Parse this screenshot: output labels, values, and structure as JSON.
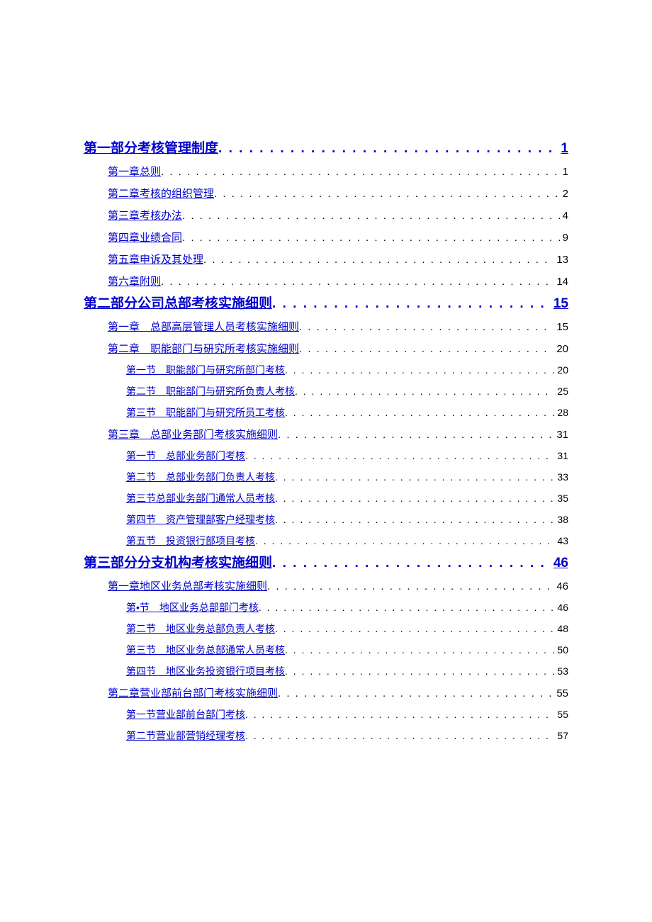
{
  "toc": [
    {
      "level": 1,
      "title": "第一部分考核管理制度",
      "page": "1"
    },
    {
      "level": 2,
      "title": "第一章总则",
      "page": "1"
    },
    {
      "level": 2,
      "title": "第二章考核的组织管理",
      "page": "2"
    },
    {
      "level": 2,
      "title": "第三章考核办法",
      "page": "4"
    },
    {
      "level": 2,
      "title": "第四章业绩合同",
      "page": "9"
    },
    {
      "level": 2,
      "title": "第五章申诉及其处理",
      "page": "13"
    },
    {
      "level": 2,
      "title": "第六章附则",
      "page": "14"
    },
    {
      "level": 1,
      "title": "第二部分公司总部考核实施细则",
      "page": "15"
    },
    {
      "level": 2,
      "title": "第一章　总部高层管理人员考核实施细则",
      "page": "15"
    },
    {
      "level": 2,
      "title": "第二章　职能部门与研究所考核实施细则",
      "page": "20"
    },
    {
      "level": 3,
      "title": "第一节　职能部门与研究所部门考核",
      "page": "20"
    },
    {
      "level": 3,
      "title": "第二节　职能部门与研究所负责人考核",
      "page": "25"
    },
    {
      "level": 3,
      "title": "第三节　职能部门与研究所员工考核",
      "page": "28"
    },
    {
      "level": 2,
      "title": "第三章　总部业务部门考核实施细则",
      "page": "31"
    },
    {
      "level": 3,
      "title": "第一节　总部业务部门考核",
      "page": "31"
    },
    {
      "level": 3,
      "title": "第二节　总部业务部门负责人考核",
      "page": "33"
    },
    {
      "level": 3,
      "title": "第三节总部业务部门通常人员考核",
      "page": "35"
    },
    {
      "level": 3,
      "title": "第四节　资产管理部客户经理考核",
      "page": "38"
    },
    {
      "level": 3,
      "title": "第五节　投资银行部项目考核",
      "page": "43"
    },
    {
      "level": 1,
      "title": "第三部分分支机构考核实施细则",
      "page": "46"
    },
    {
      "level": 2,
      "title": "第一章地区业务总部考核实施细则",
      "page": "46"
    },
    {
      "level": 3,
      "title": "第•节　地区业务总部部门考核",
      "page": "46"
    },
    {
      "level": 3,
      "title": "第二节　地区业务总部负责人考核",
      "page": "48"
    },
    {
      "level": 3,
      "title": "第三节　地区业务总部通常人员考核",
      "page": "50"
    },
    {
      "level": 3,
      "title": "第四节　地区业务投资银行项目考核",
      "page": "53"
    },
    {
      "level": 2,
      "title": "第二章营业部前台部门考核实施细则",
      "page": "55"
    },
    {
      "level": 3,
      "title": "第一节营业部前台部门考核",
      "page": "55"
    },
    {
      "level": 3,
      "title": "第二节营业部营销经理考核",
      "page": "57"
    }
  ]
}
